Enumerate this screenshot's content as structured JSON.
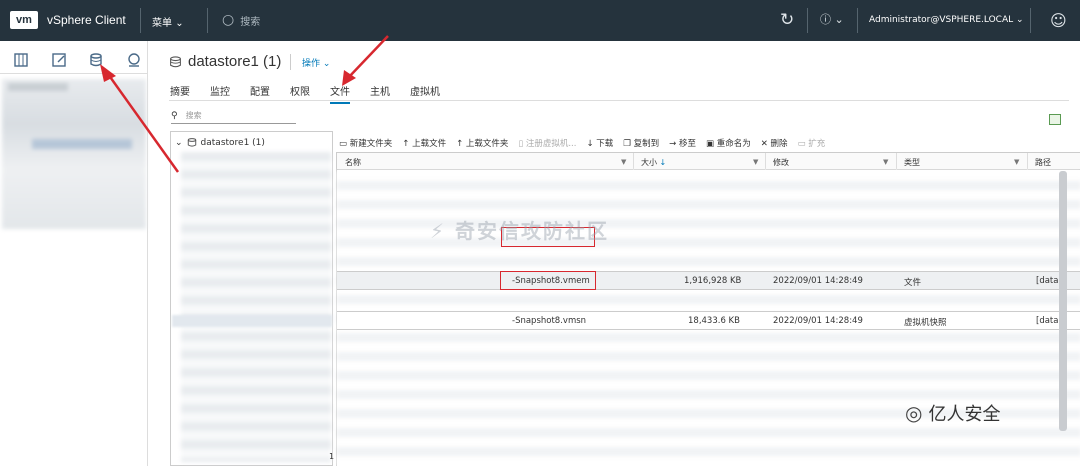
{
  "header": {
    "logo": "vm",
    "app_title": "vSphere Client",
    "menu_label": "菜单",
    "search_placeholder": "搜索",
    "user": "Administrator@VSPHERE.LOCAL"
  },
  "datastore": {
    "title": "datastore1 (1)",
    "actions_label": "操作"
  },
  "tabs": [
    "摘要",
    "监控",
    "配置",
    "权限",
    "文件",
    "主机",
    "虚拟机"
  ],
  "active_tab": "文件",
  "file_search_placeholder": "搜索",
  "tree": {
    "root": "datastore1 (1)"
  },
  "toolbar": {
    "new_folder": "新建文件夹",
    "upload_file": "上载文件",
    "upload_folder": "上载文件夹",
    "register_vm": "注册虚拟机...",
    "download": "下载",
    "copy_to": "复制到",
    "move_to": "移至",
    "rename": "重命名为",
    "delete": "删除",
    "inflate": "扩充"
  },
  "columns": {
    "name": "名称",
    "size": "大小",
    "modified": "修改",
    "type": "类型",
    "path": "路径"
  },
  "rows": [
    {
      "name": "-Snapshot8.vmem",
      "size": "1,916,928 KB",
      "modified": "2022/09/01 14:28:49",
      "type": "文件",
      "path": "[data"
    },
    {
      "name": "-Snapshot8.vmsn",
      "size": "18,433.6 KB",
      "modified": "2022/09/01 14:28:49",
      "type": "虚拟机快照",
      "path": "[data"
    }
  ],
  "tree_scroll_number": "1",
  "watermark": "奇安信攻防社区",
  "brand": "亿人安全",
  "colors": {
    "header_bg": "#25333d",
    "accent": "#0079b8",
    "highlight": "#d7282f"
  }
}
